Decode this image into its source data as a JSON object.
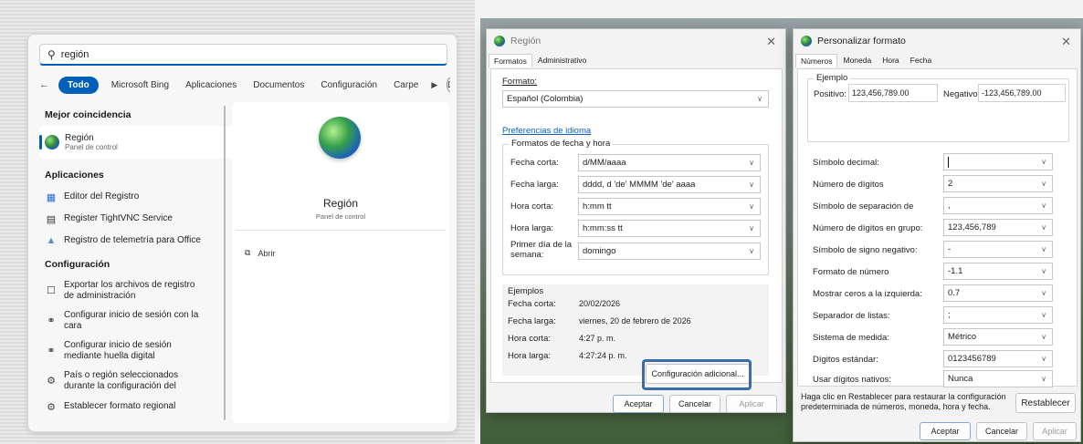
{
  "search": {
    "query": "región",
    "filters": [
      "Todo",
      "Microsoft Bing",
      "Aplicaciones",
      "Documentos",
      "Configuración",
      "Carpe"
    ],
    "avatar_letter": "D",
    "more": "···",
    "sections": {
      "best": "Mejor coincidencia",
      "apps": "Aplicaciones",
      "settings": "Configuración"
    },
    "best_match": {
      "title": "Región",
      "subtitle": "Panel de control"
    },
    "apps": [
      {
        "label": "Editor del Registro",
        "icon": "registry-icon"
      },
      {
        "label": "Register TightVNC Service",
        "icon": "vnc-icon"
      },
      {
        "label": "Registro de telemetría para Office",
        "icon": "office-telemetry-icon"
      }
    ],
    "settings": [
      {
        "label": "Exportar los archivos de registro de administración",
        "icon": "export-icon"
      },
      {
        "label": "Configurar inicio de sesión con la cara",
        "icon": "key-icon"
      },
      {
        "label": "Configurar inicio de sesión mediante huella digital",
        "icon": "key-icon"
      },
      {
        "label": "País o región seleccionados durante la configuración del",
        "icon": "region-settings-icon"
      },
      {
        "label": "Establecer formato regional",
        "icon": "region-settings-icon"
      }
    ],
    "preview": {
      "title": "Región",
      "subtitle": "Panel de control",
      "open": "Abrir"
    }
  },
  "region": {
    "title": "Región",
    "tabs": [
      "Formatos",
      "Administrativo"
    ],
    "format_label": "Formato:",
    "format_value": "Español (Colombia)",
    "lang_prefs": "Preferencias de idioma",
    "datetime_group": "Formatos de fecha y hora",
    "fields": [
      {
        "label": "Fecha corta:",
        "value": "d/MM/aaaa"
      },
      {
        "label": "Fecha larga:",
        "value": "dddd, d 'de' MMMM 'de' aaaa"
      },
      {
        "label": "Hora corta:",
        "value": "h:mm tt"
      },
      {
        "label": "Hora larga:",
        "value": "h:mm:ss tt"
      },
      {
        "label": "Primer día de la semana:",
        "value": "domingo"
      }
    ],
    "examples_group": "Ejemplos",
    "examples": [
      {
        "label": "Fecha corta:",
        "value": "20/02/2026"
      },
      {
        "label": "Fecha larga:",
        "value": "viernes, 20 de febrero de 2026"
      },
      {
        "label": "Hora corta:",
        "value": "4:27 p. m."
      },
      {
        "label": "Hora larga:",
        "value": "4:27:24 p. m."
      }
    ],
    "additional": "Configuración adicional...",
    "buttons": {
      "ok": "Aceptar",
      "cancel": "Cancelar",
      "apply": "Aplicar"
    }
  },
  "custom_format": {
    "title": "Personalizar formato",
    "tabs": [
      "Números",
      "Moneda",
      "Hora",
      "Fecha"
    ],
    "example_group": "Ejemplo",
    "positive_label": "Positivo:",
    "positive_value": "123,456,789.00",
    "negative_label": "Negativo",
    "negative_value": "-123,456,789.00",
    "fields": [
      {
        "label": "Símbolo decimal:",
        "value": ""
      },
      {
        "label": "Número de dígitos",
        "value": "2"
      },
      {
        "label": "Símbolo de separación de",
        "value": ","
      },
      {
        "label": "Número de dígitos en grupo:",
        "value": "123,456,789"
      },
      {
        "label": "Símbolo de signo negativo:",
        "value": "-"
      },
      {
        "label": "Formato de número",
        "value": "-1.1"
      },
      {
        "label": "Mostrar ceros a la izquierda:",
        "value": "0.7"
      },
      {
        "label": "Separador de listas:",
        "value": ";"
      },
      {
        "label": "Sistema de medida:",
        "value": "Métrico"
      },
      {
        "label": "Dígitos estándar:",
        "value": "0123456789"
      },
      {
        "label": "Usar dígitos nativos:",
        "value": "Nunca"
      }
    ],
    "reset_text": "Haga clic en Restablecer para restaurar la configuración predeterminada de números, moneda, hora y fecha.",
    "reset_button": "Restablecer",
    "buttons": {
      "ok": "Aceptar",
      "cancel": "Cancelar",
      "apply": "Aplicar"
    }
  },
  "colors": {
    "accent": "#005fb8",
    "highlight": "#3a6ea8"
  }
}
